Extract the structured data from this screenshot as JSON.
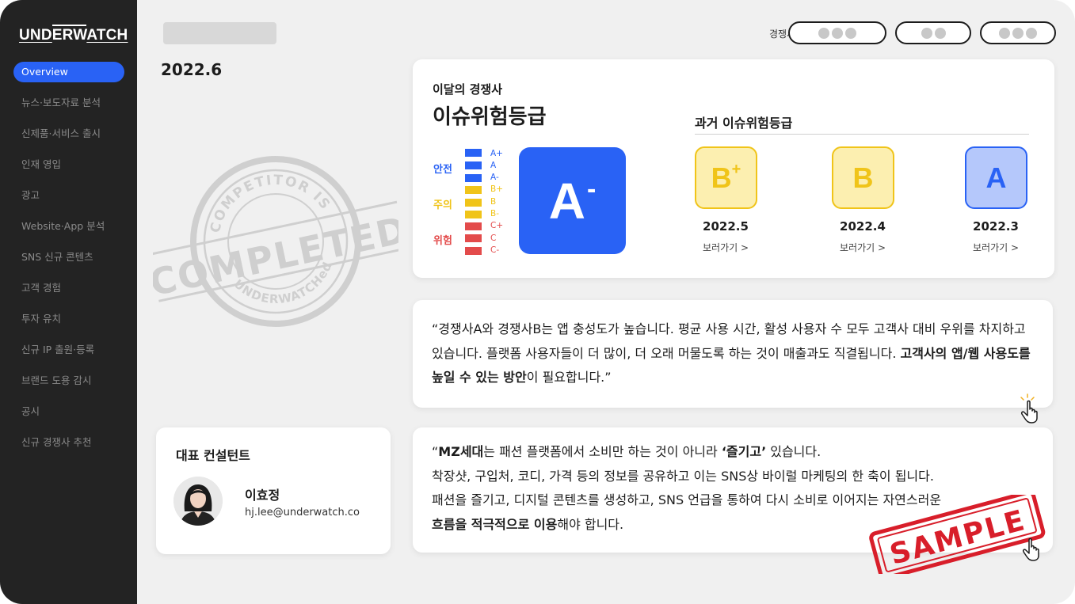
{
  "sidebar": {
    "logo": {
      "part1": "UND",
      "part2": "ERW",
      "part3": "ATCH"
    },
    "items": [
      {
        "label": "Overview",
        "active": true
      },
      {
        "label": "뉴스·보도자료 분석"
      },
      {
        "label": "신제품·서비스 출시"
      },
      {
        "label": "인재 영입"
      },
      {
        "label": "광고"
      },
      {
        "label": "Website·App 분석"
      },
      {
        "label": "SNS 신규 콘텐츠"
      },
      {
        "label": "고객 경험"
      },
      {
        "label": "투자 유치"
      },
      {
        "label": "신규 IP 출원·등록"
      },
      {
        "label": "브랜드 도용 감시"
      },
      {
        "label": "공시"
      },
      {
        "label": "신규 경쟁사 추천"
      }
    ]
  },
  "header": {
    "date": "2022.6",
    "competitor_label": "경쟁사"
  },
  "risk": {
    "subtitle": "이달의 경쟁사",
    "title": "이슈위험등급",
    "current_grade": {
      "letter": "A",
      "sign": "-"
    },
    "legend": [
      {
        "label": "안전",
        "color": "#2962f5",
        "grades": [
          "A+",
          "A",
          "A-"
        ]
      },
      {
        "label": "주의",
        "color": "#f0c419",
        "grades": [
          "B+",
          "B",
          "B-"
        ]
      },
      {
        "label": "위험",
        "color": "#e34b4b",
        "grades": [
          "C+",
          "C",
          "C-"
        ]
      }
    ],
    "past_title": "과거 이슈위험등급",
    "past": [
      {
        "letter": "B",
        "sign": "+",
        "date": "2022.5",
        "link": "보러가기 >"
      },
      {
        "letter": "B",
        "sign": "",
        "date": "2022.4",
        "link": "보러가기 >"
      },
      {
        "letter": "A",
        "sign": "",
        "date": "2022.3",
        "link": "보러가기 >"
      }
    ]
  },
  "insight1": {
    "text1": "“경쟁사A와 경쟁사B는 앱 충성도가 높습니다. 평균 사용 시간, 활성 사용자 수 모두 고객사 대비 우위를 차지하고 있습니다. 플랫폼 사용자들이 더 많이, 더 오래 머물도록 하는 것이 매출과도 직결됩니다. ",
    "bold": "고객사의 앱/웹 사용도를 높일 수 있는 방안",
    "text2": "이 필요합니다.”"
  },
  "insight2": {
    "q_open": "“",
    "bold1": "MZ세대",
    "text1": "는 패션 플랫폼에서 소비만 하는 것이 아니라 ",
    "bold2": "‘즐기고’",
    "text2": " 있습니다.",
    "line2": "착장샷, 구입처, 코디, 가격 등의 정보를 공유하고 이는 SNS상 바이럴 마케팅의 한 축이 됩니다.",
    "line3": "패션을 즐기고, 디지털 콘텐츠를 생성하고, SNS 언급을 통하여 다시 소비로 이어지는 자연스러운",
    "bold3": "흐름을 적극적으로 이용",
    "text4": "해야 합니다."
  },
  "consultant": {
    "title": "대표 컨설턴트",
    "name": "이효정",
    "email": "hj.lee@underwatch.co"
  },
  "stamp": {
    "top": "COMPETITOR IS",
    "middle": "COMPLETED",
    "bottom": "UNDERWATCHed"
  },
  "sample_stamp": "SAMPLE",
  "colors": {
    "accent": "#2962f5",
    "sidebar": "#232323",
    "caution": "#f0c419",
    "danger": "#e34b4b"
  }
}
